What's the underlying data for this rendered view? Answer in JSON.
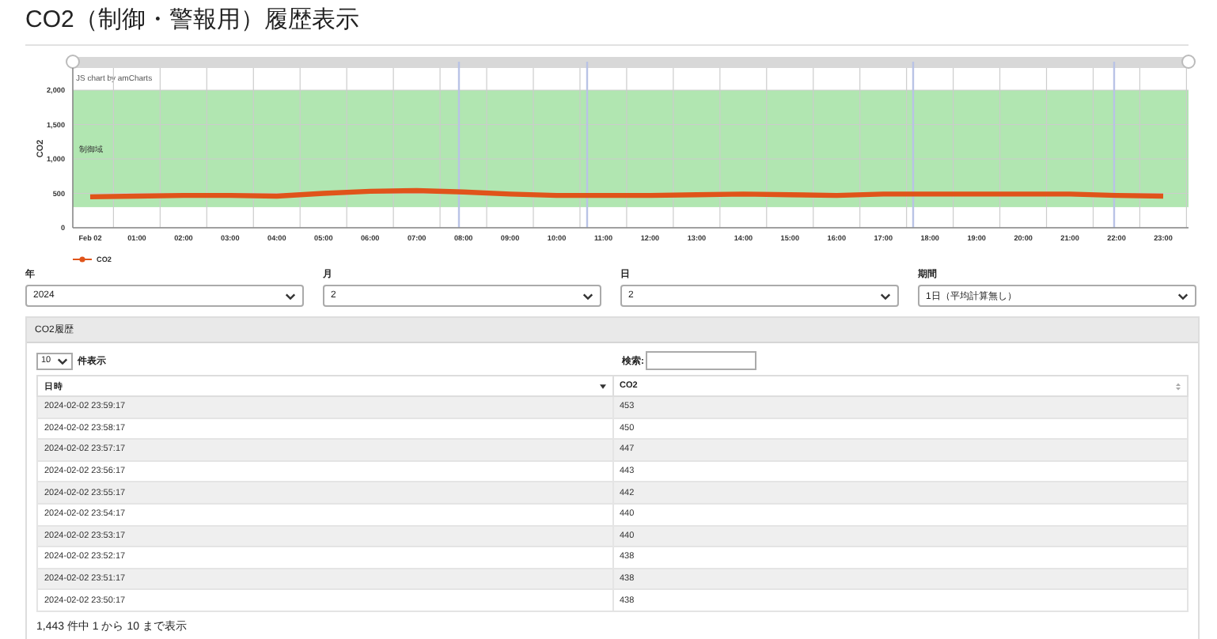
{
  "title": "CO2（制御・警報用）履歴表示",
  "chart": {
    "credit": "JS chart by amCharts",
    "chart_data": {
      "type": "line",
      "ylabel": "CO2",
      "categories": [
        "Feb 02",
        "01:00",
        "02:00",
        "03:00",
        "04:00",
        "05:00",
        "06:00",
        "07:00",
        "08:00",
        "09:00",
        "10:00",
        "11:00",
        "12:00",
        "13:00",
        "14:00",
        "15:00",
        "16:00",
        "17:00",
        "18:00",
        "19:00",
        "20:00",
        "21:00",
        "22:00",
        "23:00"
      ],
      "series": [
        {
          "name": "CO2",
          "color": "#e0541a",
          "values": [
            450,
            460,
            470,
            470,
            460,
            500,
            530,
            540,
            520,
            490,
            470,
            470,
            470,
            480,
            490,
            480,
            470,
            490,
            490,
            490,
            490,
            490,
            470,
            460
          ]
        }
      ],
      "ylim": [
        0,
        2000
      ],
      "yticks": [
        {
          "value": 0,
          "label": "0"
        },
        {
          "value": 500,
          "label": "500"
        },
        {
          "value": 1000,
          "label": "1,000"
        },
        {
          "value": 1500,
          "label": "1,500"
        },
        {
          "value": 2000,
          "label": "2,000"
        }
      ],
      "grid": true,
      "bands": [
        {
          "axis": "y",
          "from": 300,
          "to": 2000,
          "label": "制御域"
        }
      ]
    }
  },
  "filters": [
    {
      "label": "年",
      "value": "2024"
    },
    {
      "label": "月",
      "value": "2"
    },
    {
      "label": "日",
      "value": "2"
    },
    {
      "label": "期間",
      "value": "1日（平均計算無し）"
    }
  ],
  "history": {
    "title": "CO2履歴",
    "page_size": "10",
    "page_size_label": "件表示",
    "search_label": "検索:",
    "columns": [
      {
        "label": "日時",
        "sorted": true
      },
      {
        "label": "CO2",
        "sorted": false
      }
    ],
    "rows": [
      [
        "2024-02-02 23:59:17",
        "453"
      ],
      [
        "2024-02-02 23:58:17",
        "450"
      ],
      [
        "2024-02-02 23:57:17",
        "447"
      ],
      [
        "2024-02-02 23:56:17",
        "443"
      ],
      [
        "2024-02-02 23:55:17",
        "442"
      ],
      [
        "2024-02-02 23:54:17",
        "440"
      ],
      [
        "2024-02-02 23:53:17",
        "440"
      ],
      [
        "2024-02-02 23:52:17",
        "438"
      ],
      [
        "2024-02-02 23:51:17",
        "438"
      ],
      [
        "2024-02-02 23:50:17",
        "438"
      ]
    ],
    "info": "1,443 件中 1 から 10 まで表示"
  }
}
